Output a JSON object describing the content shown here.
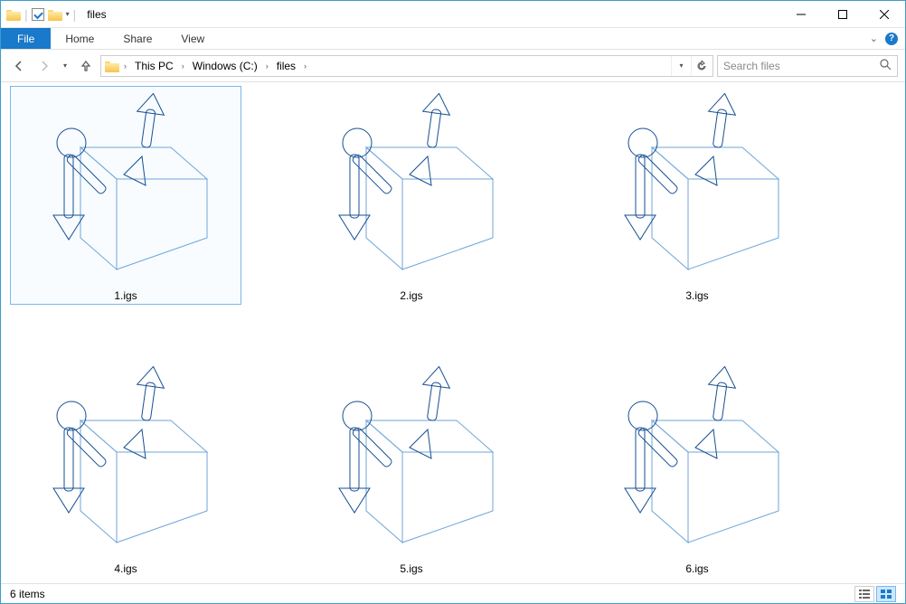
{
  "window": {
    "title": "files"
  },
  "ribbon": {
    "file": "File",
    "tabs": [
      "Home",
      "Share",
      "View"
    ]
  },
  "breadcrumb": {
    "segments": [
      "This PC",
      "Windows (C:)",
      "files"
    ]
  },
  "search": {
    "placeholder": "Search files"
  },
  "files": [
    {
      "name": "1.igs",
      "selected": true
    },
    {
      "name": "2.igs",
      "selected": false
    },
    {
      "name": "3.igs",
      "selected": false
    },
    {
      "name": "4.igs",
      "selected": false
    },
    {
      "name": "5.igs",
      "selected": false
    },
    {
      "name": "6.igs",
      "selected": false
    }
  ],
  "status": {
    "item_count": "6 items"
  }
}
